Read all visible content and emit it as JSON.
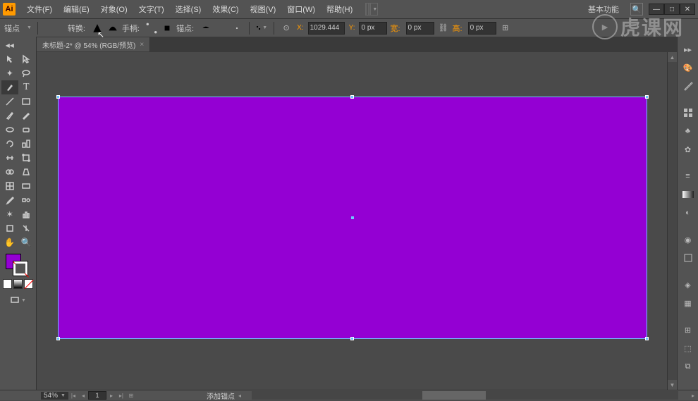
{
  "app": {
    "icon_text": "Ai"
  },
  "menu": [
    "文件(F)",
    "编辑(E)",
    "对象(O)",
    "文字(T)",
    "选择(S)",
    "效果(C)",
    "视图(V)",
    "窗口(W)",
    "帮助(H)"
  ],
  "workspace": "基本功能",
  "control": {
    "anchor_label": "锚点",
    "convert_label": "转换:",
    "handle_label": "手柄:",
    "anchors_label": "锚点:",
    "x_label": "X:",
    "x_value": "1029.444",
    "y_label": "Y:",
    "y_value": "0 px",
    "w_label": "宽:",
    "w_value": "0 px",
    "h_label": "高:",
    "h_value": "0 px"
  },
  "tab": {
    "label": "未标题-2* @ 54% (RGB/预览)",
    "close": "×"
  },
  "status": {
    "zoom": "54%",
    "page": "1",
    "message": "添加锚点"
  },
  "colors": {
    "fill": "#9400d3",
    "accent": "#ff9a00",
    "selection": "#6fc3ff"
  },
  "watermark": "虎课网"
}
